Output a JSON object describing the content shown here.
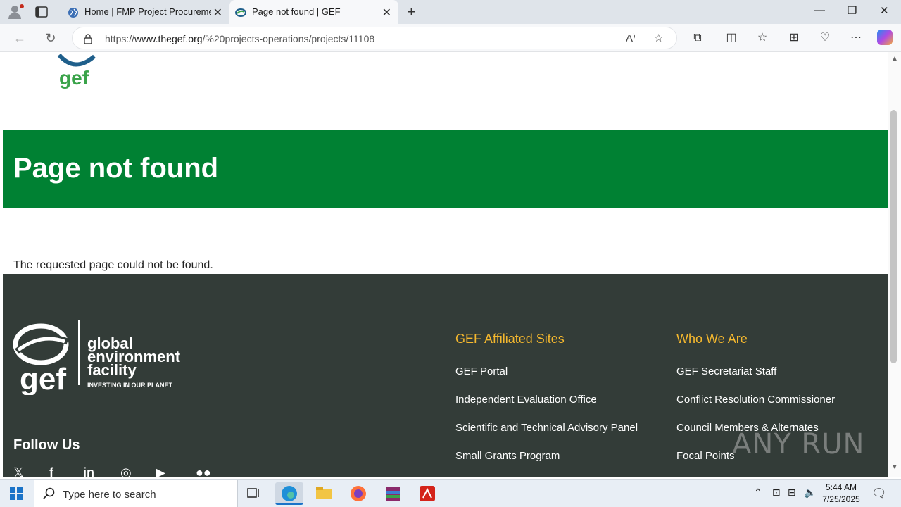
{
  "browser": {
    "tabs": [
      {
        "title": "Home | FMP Project Procurement",
        "active": false
      },
      {
        "title": "Page not found | GEF",
        "active": true
      }
    ],
    "url_prefix": "https://",
    "url_domain": "www.thegef.org",
    "url_path": "/%20projects-operations/projects/11108"
  },
  "page": {
    "heading": "Page not found",
    "message": "The requested page could not be found.",
    "accent_color": "#008133"
  },
  "footer": {
    "logo_lines": [
      "global",
      "environment",
      "facility"
    ],
    "logo_tagline": "INVESTING IN OUR PLANET",
    "follow_label": "Follow Us",
    "social": [
      "x-icon",
      "facebook-icon",
      "linkedin-icon",
      "instagram-icon",
      "youtube-icon",
      "flickr-icon"
    ],
    "columns": [
      {
        "title": "GEF Affiliated Sites",
        "links": [
          "GEF Portal",
          "Independent Evaluation Office",
          "Scientific and Technical Advisory Panel",
          "Small Grants Program"
        ]
      },
      {
        "title": "Who We Are",
        "links": [
          "GEF Secretariat Staff",
          "Conflict Resolution Commissioner",
          "Council Members & Alternates",
          "Focal Points"
        ]
      }
    ],
    "title_color": "#f5b82e",
    "background": "#333c38"
  },
  "watermark": "ANY RUN",
  "taskbar": {
    "search_placeholder": "Type here to search",
    "time": "5:44 AM",
    "date": "7/25/2025"
  }
}
